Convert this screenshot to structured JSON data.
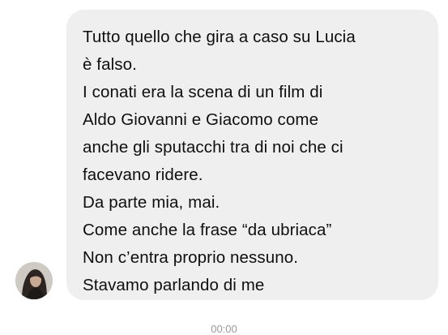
{
  "chat": {
    "message": {
      "lines": [
        "Tutto quello che gira a caso su Lucia",
        "è falso.",
        "I conati era la scena di un film di",
        "Aldo Giovanni e Giacomo come",
        "anche gli sputacchi tra di noi che ci",
        "facevano ridere.",
        "Da parte mia, mai.",
        "Come anche la frase “da ubriaca”",
        "Non c’entra proprio nessuno.",
        "Stavamo parlando di me"
      ]
    },
    "timestamp": "00:00"
  },
  "colors": {
    "bubble": "#efefef",
    "text": "#0f0f0f",
    "timestamp": "#9a9a9a",
    "background": "#ffffff"
  }
}
